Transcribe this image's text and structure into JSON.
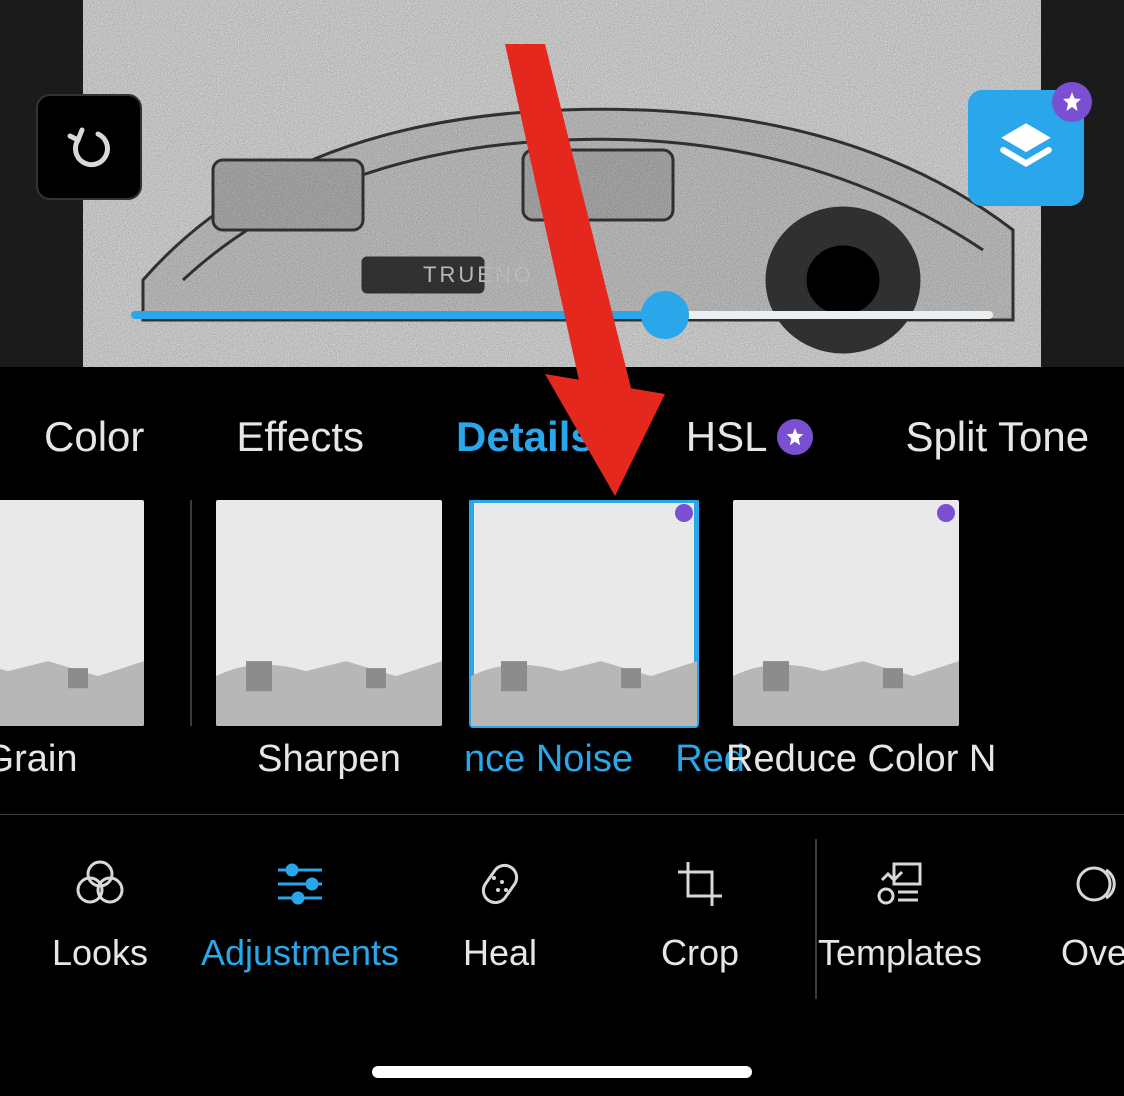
{
  "preview": {
    "plate_text": "TRUENO"
  },
  "slider": {
    "percent": 62
  },
  "tabs": [
    {
      "label": "Color",
      "premium": false,
      "active": false
    },
    {
      "label": "Effects",
      "premium": false,
      "active": false
    },
    {
      "label": "Details",
      "premium": false,
      "active": true
    },
    {
      "label": "HSL",
      "premium": true,
      "active": false
    },
    {
      "label": "Split Tone",
      "premium": false,
      "active": false
    }
  ],
  "detail_thumbs": [
    {
      "label": "Grain",
      "premium": false,
      "selected": false,
      "clip_left": true
    },
    {
      "label": "Sharpen",
      "premium": false,
      "selected": false
    },
    {
      "label": "Reduce Luminance Noise",
      "premium": true,
      "selected": true,
      "label_clip": "nce Noise    Red"
    },
    {
      "label": "Reduce Color Noise",
      "premium": true,
      "selected": false,
      "label_clip": "Reduce Color N"
    }
  ],
  "tools": [
    {
      "label": "Looks",
      "active": false
    },
    {
      "label": "Adjustments",
      "active": true
    },
    {
      "label": "Heal",
      "active": false
    },
    {
      "label": "Crop",
      "active": false
    },
    {
      "label": "Templates",
      "active": false
    },
    {
      "label": "Overlays",
      "active": false,
      "label_clip": "Over"
    }
  ],
  "colors": {
    "accent": "#2aa6ea",
    "premium": "#7b4fd1"
  }
}
